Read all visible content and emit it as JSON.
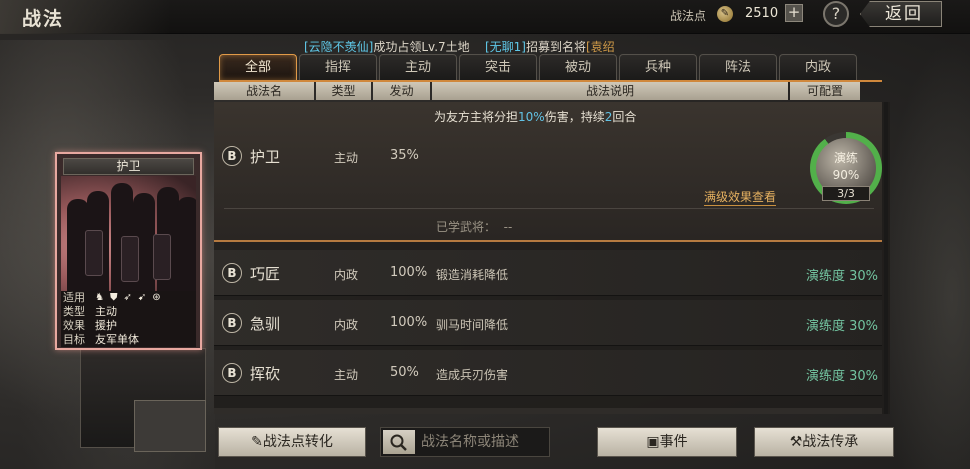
{
  "header": {
    "title": "战法",
    "points_label": "战法点",
    "points_value": "2510",
    "plus": "+",
    "help": "?",
    "back": "返回"
  },
  "ticker": {
    "a_name": "[云隐不羡仙]",
    "a_text": "成功占领Lv.7土地",
    "b_name": "[无聊1]",
    "b_text": "招募到名将",
    "b_tail": "[袁绍"
  },
  "tabs": [
    "全部",
    "指挥",
    "主动",
    "突击",
    "被动",
    "兵种",
    "阵法",
    "内政"
  ],
  "columns": [
    "战法名",
    "类型",
    "发动",
    "战法说明",
    "可配置"
  ],
  "selected_card": {
    "title": "护卫",
    "rows": [
      {
        "key": "适用",
        "val": ""
      },
      {
        "key": "类型",
        "val": "主动"
      },
      {
        "key": "效果",
        "val": "援护"
      },
      {
        "key": "目标",
        "val": "友军单体"
      }
    ],
    "unit_icons": [
      "cavalry-icon",
      "shield-icon",
      "bow-icon",
      "spear-icon",
      "siege-icon"
    ]
  },
  "expanded": {
    "badge": "B",
    "name": "护卫",
    "type": "主动",
    "rate": "35%",
    "desc_pre": "为友方主将分担",
    "desc_num1": "10%",
    "desc_mid": "伤害，持续",
    "desc_num2": "2",
    "desc_post": "回合",
    "practice_label": "演练",
    "practice_percent": "90%",
    "practice_fraction": 0.9,
    "practice_count": "3/3",
    "full_effect_link": "满级效果查看",
    "learned_label": "已学武将：",
    "learned_value": "--"
  },
  "rows": [
    {
      "badge": "B",
      "name": "巧匠",
      "type": "内政",
      "rate": "100%",
      "desc": "锻造消耗降低",
      "prof": "演练度 30%"
    },
    {
      "badge": "B",
      "name": "急驯",
      "type": "内政",
      "rate": "100%",
      "desc": "驯马时间降低",
      "prof": "演练度 30%"
    },
    {
      "badge": "B",
      "name": "挥砍",
      "type": "主动",
      "rate": "50%",
      "desc": "造成兵刃伤害",
      "prof": "演练度 30%"
    }
  ],
  "bottom": {
    "convert": "战法点转化",
    "search_placeholder": "战法名称或描述",
    "events": "事件",
    "inherit": "战法传承"
  },
  "colors": {
    "accent_orange": "#e09a48",
    "practice_green": "#52b04a",
    "number_blue": "#62c2e4",
    "proficiency_green": "#72c4a0"
  }
}
